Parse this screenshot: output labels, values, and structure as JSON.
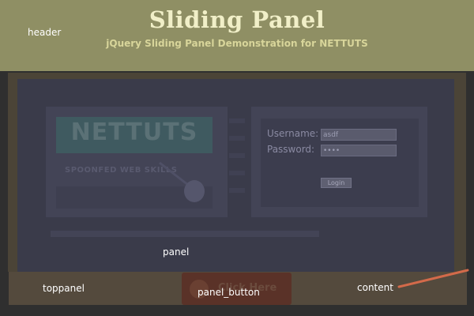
{
  "header": {
    "region_label": "header",
    "title": "Sliding Panel",
    "subtitle": "jQuery Sliding Panel Demonstration for NETTUTS"
  },
  "panel": {
    "region_label": "panel",
    "logo": {
      "name": "NETTUTS",
      "tagline": "SPOONFED WEB SKILLS"
    },
    "login": {
      "username_label": "Username:",
      "username_value": "asdf",
      "password_label": "Password:",
      "password_value": "••••",
      "submit_label": "Login"
    }
  },
  "toppanel": {
    "region_label": "toppanel"
  },
  "panel_button": {
    "region_label": "panel_button",
    "text": "Click Here"
  },
  "content": {
    "region_label": "content"
  },
  "colors": {
    "header_bg": "#8f8f64",
    "title": "#f1efc8",
    "panel_bg": "#3a3b4a",
    "toppanel_bg": "#544a3d",
    "button_bg": "#5a3228",
    "pointer": "#d36a4a"
  },
  "icons": {
    "spoon": "spoon-icon",
    "button_dot": "circle-icon",
    "pointer": "pointer-line-icon"
  }
}
